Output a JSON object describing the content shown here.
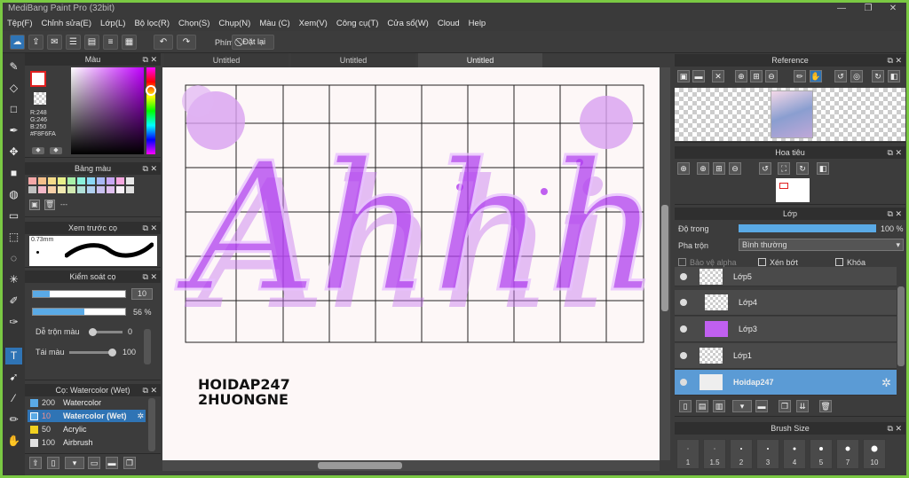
{
  "window": {
    "title": "MediBang Paint Pro (32bit)"
  },
  "menu": [
    "Tệp(F)",
    "Chỉnh sửa(E)",
    "Lớp(L)",
    "Bộ lọc(R)",
    "Chọn(S)",
    "Chụp(N)",
    "Màu (C)",
    "Xem(V)",
    "Công cụ(T)",
    "Cửa sổ(W)",
    "Cloud",
    "Help"
  ],
  "toolbar": {
    "shortcut_label": "Phím",
    "reset_label": "Đặt lại"
  },
  "color_panel": {
    "title": "Màu",
    "readout": [
      "R:248",
      "G:246",
      "B:250",
      "#F8F6FA"
    ]
  },
  "palette_panel": {
    "title": "Bảng màu",
    "swatches": [
      "#f6a8a8",
      "#f6c08a",
      "#f6dc8a",
      "#e8f08a",
      "#a8f0a8",
      "#8af0dc",
      "#8ad8f6",
      "#a8b8f6",
      "#c8a8f6",
      "#f6a8e0",
      "#e8e8e8",
      "#c0c0c0",
      "#f4b8c8",
      "#f8d0a8",
      "#f0e8b0",
      "#d0e8b0",
      "#b0e0d8",
      "#b0d0f0",
      "#c8c0f0",
      "#e0c0f0",
      "#f8f0f8",
      "#e0e0e0"
    ],
    "more": "---"
  },
  "preview_panel": {
    "title": "Xem trước cọ",
    "size": "0.73mm"
  },
  "brush_control": {
    "title": "Kiểm soát cọ",
    "size_value": "10",
    "opacity_value": "56",
    "opacity_unit": "%",
    "mix_label": "Dễ trộn màu",
    "mix_value": "0",
    "resample_label": "Tái màu",
    "resample_value": "100",
    "opacity_fraction": 0.56
  },
  "brush_panel": {
    "title": "Cọ: Watercolor (Wet)",
    "brushes": [
      {
        "size": "200",
        "name": "Watercolor",
        "color": "#5aaae6"
      },
      {
        "size": "10",
        "name": "Watercolor (Wet)",
        "color": "#5aaae6"
      },
      {
        "size": "50",
        "name": "Acrylic",
        "color": "#f0d020"
      },
      {
        "size": "100",
        "name": "Airbrush",
        "color": "#e0e0e0"
      }
    ]
  },
  "tabs": [
    "Untitled",
    "Untitled",
    "Untitled"
  ],
  "artwork": {
    "title": "Ahhhi",
    "caption_line1": "HOIDAP247",
    "caption_line2": "2HUONGNE"
  },
  "reference_panel": {
    "title": "Reference"
  },
  "navigator_panel": {
    "title": "Hoa tiêu"
  },
  "layer_panel": {
    "title": "Lớp",
    "opacity_label": "Độ trong",
    "opacity_value": "100 %",
    "opacity_fraction": 1.0,
    "blend_label": "Pha trộn",
    "blend_value": "Bình thường",
    "protect_alpha": "Bảo vệ alpha",
    "clipping": "Xén bớt",
    "lock": "Khóa",
    "layers": [
      {
        "name": "Lớp5",
        "thumb": "checker"
      },
      {
        "name": "Lớp4",
        "thumb": "checker"
      },
      {
        "name": "Lớp3",
        "thumb": "#c060f0"
      },
      {
        "name": "Lớp1",
        "thumb": "checker"
      },
      {
        "name": "Hoidap247",
        "thumb": "text"
      }
    ]
  },
  "brush_size_panel": {
    "title": "Brush Size",
    "sizes": [
      "1",
      "1.5",
      "2",
      "3",
      "4",
      "5",
      "7",
      "10"
    ]
  },
  "colors": {
    "accent": "#2f74b5",
    "green_border": "#7ac943",
    "purple": "#c060f0"
  }
}
